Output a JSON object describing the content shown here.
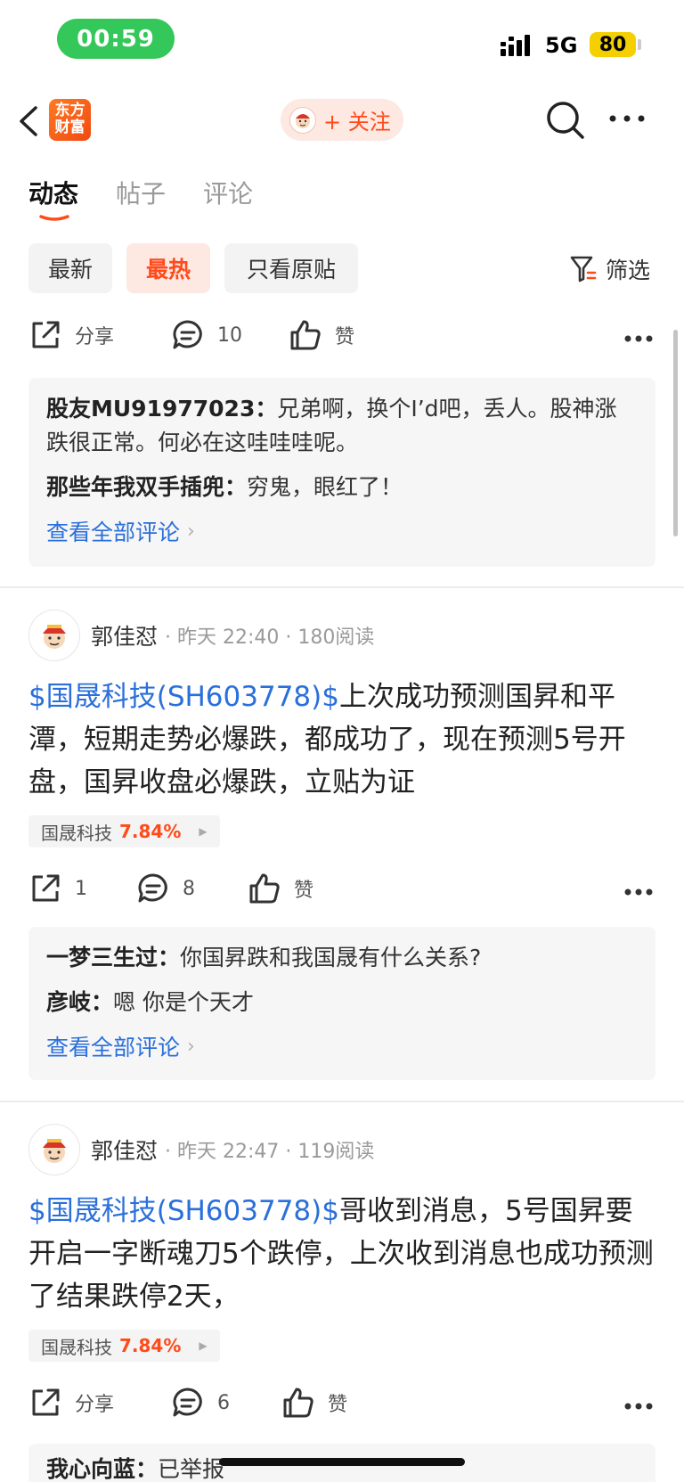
{
  "status_bar": {
    "time": "00:59",
    "network": "5G",
    "battery": "80"
  },
  "header": {
    "logo_text_line1": "东方",
    "logo_text_line2": "财富",
    "follow_label": "+ 关注"
  },
  "tabs": [
    {
      "label": "动态",
      "active": true
    },
    {
      "label": "帖子",
      "active": false
    },
    {
      "label": "评论",
      "active": false
    }
  ],
  "filters": {
    "chips": [
      {
        "label": "最新",
        "active": false
      },
      {
        "label": "最热",
        "active": true
      },
      {
        "label": "只看原贴",
        "active": false
      }
    ],
    "filter_label": "筛选"
  },
  "colors": {
    "accent": "#ff4a1a",
    "link": "#2a6fdb",
    "status_green": "#34c759",
    "battery": "#f5d000"
  },
  "posts": [
    {
      "actions": {
        "share": "分享",
        "comments": "10",
        "like": "赞"
      },
      "comments": [
        {
          "name": "股友MU91977023",
          "text": "兄弟啊，换个I’d吧，丢人。股神涨跌很正常。何必在这哇哇哇呢。"
        },
        {
          "name": "那些年我双手插兜",
          "text": "穷鬼，眼红了！"
        }
      ],
      "view_all": "查看全部评论"
    },
    {
      "author": "郭佳怼",
      "meta": "· 昨天 22:40 · 180阅读",
      "stock_link": "$国晟科技(SH603778)$",
      "text": "上次成功预测国昇和平潭，短期走势必爆跌，都成功了，现在预测5号开盘，国昇收盘必爆跌，立贴为证",
      "stock_tag": {
        "name": "国晟科技",
        "change": "7.84%"
      },
      "actions": {
        "share": "1",
        "comments": "8",
        "like": "赞"
      },
      "comments": [
        {
          "name": "一梦三生过",
          "text": "你国昇跌和我国晟有什么关系?"
        },
        {
          "name": "彦岐",
          "text": "嗯 你是个天才"
        }
      ],
      "view_all": "查看全部评论"
    },
    {
      "author": "郭佳怼",
      "meta": "· 昨天 22:47 · 119阅读",
      "stock_link": "$国晟科技(SH603778)$",
      "text": "哥收到消息，5号国昇要开启一字断魂刀5个跌停，上次收到消息也成功预测了结果跌停2天，",
      "stock_tag": {
        "name": "国晟科技",
        "change": "7.84%"
      },
      "actions": {
        "share": "分享",
        "comments": "6",
        "like": "赞"
      },
      "comments": [
        {
          "name": "我心向蓝",
          "text": "已举报"
        }
      ]
    }
  ]
}
